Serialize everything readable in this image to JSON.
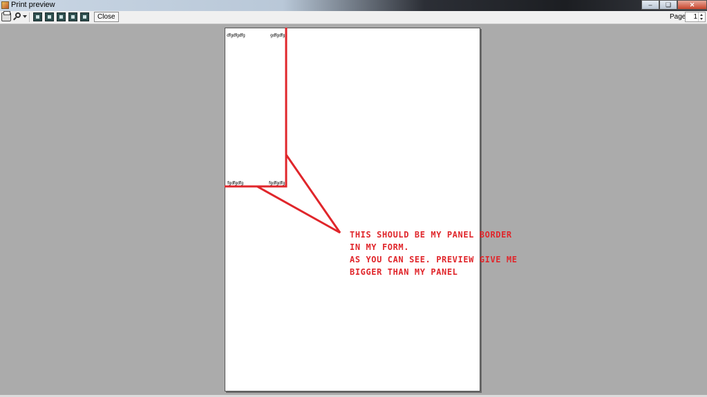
{
  "window": {
    "title": "Print preview",
    "buttons": [
      "minimize",
      "restore",
      "close"
    ]
  },
  "toolbar": {
    "icons": [
      "printer-icon",
      "zoom-icon",
      "one-page-icon",
      "two-pages-icon",
      "three-pages-icon",
      "four-pages-icon",
      "six-pages-icon"
    ],
    "close_label": "Close",
    "page_label": "Page",
    "page_value": "1"
  },
  "paper": {
    "corner_labels": [
      "dfgdfgdfg",
      "gdfgdfg",
      "fgdfgdfg",
      "fgdfgdfg"
    ]
  },
  "annotation": {
    "color": "#e0262b",
    "lines": [
      "THIS SHOULD BE MY PANEL BORDER",
      "IN MY FORM.",
      "AS YOU CAN SEE.  PREVIEW GIVE ME",
      "BIGGER THAN MY PANEL"
    ]
  }
}
